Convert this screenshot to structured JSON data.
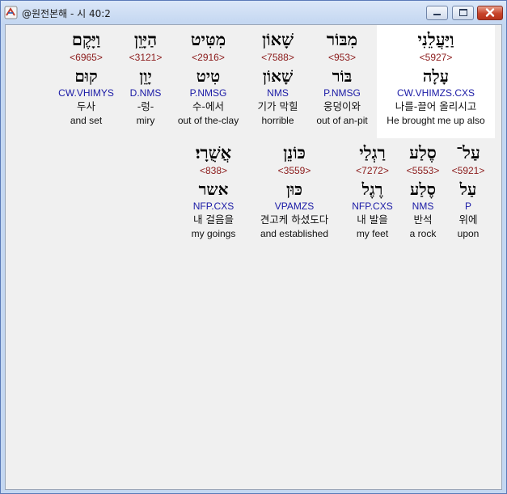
{
  "window": {
    "title": "@원전본해 - 시 40:2",
    "minimize_label": "minimize",
    "maximize_label": "maximize",
    "close_label": "close"
  },
  "verse": {
    "line1": [
      {
        "hebrew": "וַיַּעֲלֵנִי",
        "strong": "<5927>",
        "root": "עָלָה",
        "parse": "CW.VHIMZS.CXS",
        "korean": "나를-끌어 올리시고",
        "english": "He brought me up also",
        "selected": true
      },
      {
        "hebrew": "מִבּוֹר",
        "strong": "<953>",
        "root": "בּוֹר",
        "parse": "P.NMSG",
        "korean": "웅덩이와",
        "english": "out of an-pit",
        "selected": false
      },
      {
        "hebrew": "שָׁאוֹן",
        "strong": "<7588>",
        "root": "שָׁאוֹן",
        "parse": "NMS",
        "korean": "기가 막힐",
        "english": "horrible",
        "selected": false
      },
      {
        "hebrew": "מִטִּיט",
        "strong": "<2916>",
        "root": "טִיט",
        "parse": "P.NMSG",
        "korean": "수-에서",
        "english": "out of the-clay",
        "selected": false
      },
      {
        "hebrew": "הַיָּוֵן",
        "strong": "<3121>",
        "root": "יָוֵן",
        "parse": "D.NMS",
        "korean": "-렁-",
        "english": "miry",
        "selected": false
      },
      {
        "hebrew": "וַיָּקֶם",
        "strong": "<6965>",
        "root": "קוּם",
        "parse": "CW.VHIMYS",
        "korean": "두사",
        "english": "and set",
        "selected": false
      }
    ],
    "line2": [
      {
        "hebrew": "עַל־",
        "strong": "<5921>",
        "root": "עַל",
        "parse": "P",
        "korean": "위에",
        "english": "upon"
      },
      {
        "hebrew": "סֶלַע",
        "strong": "<5553>",
        "root": "סֶלַע",
        "parse": "NMS",
        "korean": "반석",
        "english": "a rock"
      },
      {
        "hebrew": "רַגְלַי",
        "strong": "<7272>",
        "root": "רֶגֶל",
        "parse": "NFP.CXS",
        "korean": "내 발을",
        "english": "my feet"
      },
      {
        "hebrew": "כּוֹנֵן",
        "strong": "<3559>",
        "root": "כּוּן",
        "parse": "VPAMZS",
        "korean": "견고케 하셨도다",
        "english": "and established"
      },
      {
        "hebrew": "אֲשֻׁרָי׃",
        "strong": "<838>",
        "root": "אשר",
        "parse": "NFP.CXS",
        "korean": "내 걸음을",
        "english": "my goings"
      }
    ]
  }
}
